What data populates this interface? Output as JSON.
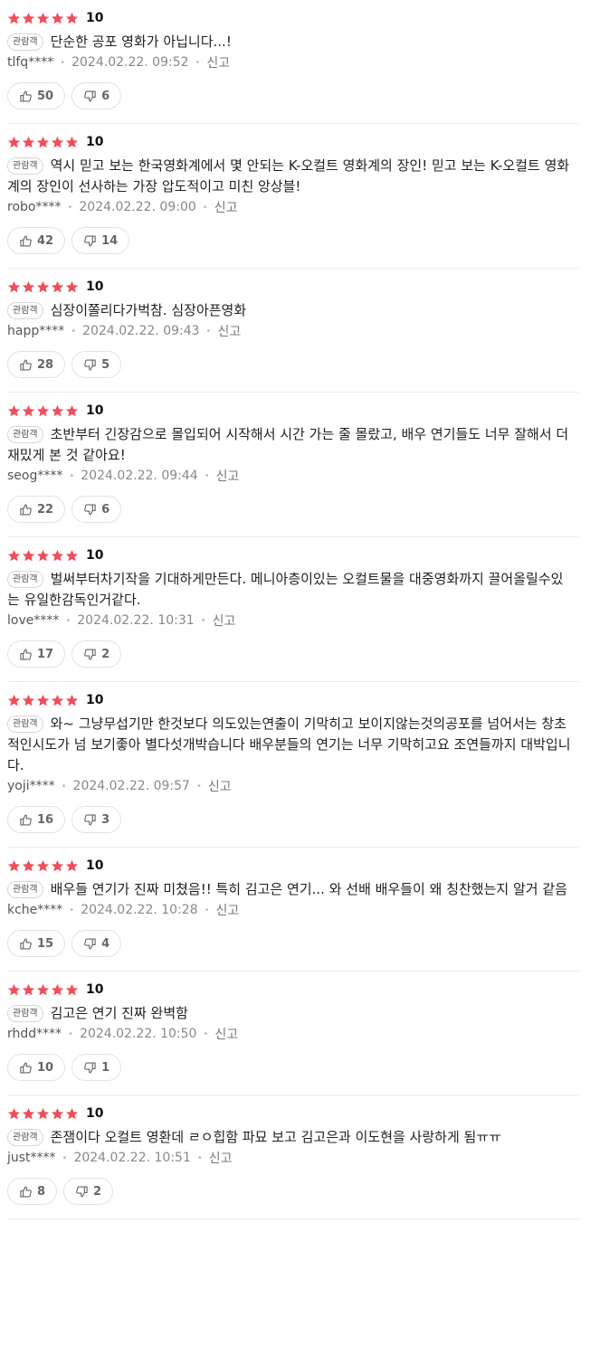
{
  "colors": {
    "star": "#ef4e5a",
    "text": "#1f1f1f",
    "meta": "#888888",
    "border": "#e3e3e3"
  },
  "reviews": [
    {
      "score": "10",
      "badge": "관람객",
      "content": "단순한 공포 영화가 아닙니다...!",
      "user": "tlfq****",
      "date": "2024.02.22. 09:52",
      "report": "신고",
      "likes": "50",
      "dislikes": "6"
    },
    {
      "score": "10",
      "badge": "관람객",
      "content": "역시 믿고 보는 한국영화계에서 몇 안되는 K-오컬트 영화계의 장인! 믿고 보는 K-오컬트 영화계의 장인이 선사하는 가장 압도적이고 미친 앙상블!",
      "user": "robo****",
      "date": "2024.02.22. 09:00",
      "report": "신고",
      "likes": "42",
      "dislikes": "14"
    },
    {
      "score": "10",
      "badge": "관람객",
      "content": "심장이쫄리다가벅참. 심장아픈영화",
      "user": "happ****",
      "date": "2024.02.22. 09:43",
      "report": "신고",
      "likes": "28",
      "dislikes": "5"
    },
    {
      "score": "10",
      "badge": "관람객",
      "content": "초반부터 긴장감으로 몰입되어 시작해서 시간 가는 줄 몰랐고, 배우 연기들도 너무 잘해서 더 재밌게 본 것 같아요!",
      "user": "seog****",
      "date": "2024.02.22. 09:44",
      "report": "신고",
      "likes": "22",
      "dislikes": "6"
    },
    {
      "score": "10",
      "badge": "관람객",
      "content": "벌써부터차기작을 기대하게만든다. 메니아층이있는 오컬트물을 대중영화까지 끌어올릴수있는 유일한감독인거같다.",
      "user": "love****",
      "date": "2024.02.22. 10:31",
      "report": "신고",
      "likes": "17",
      "dislikes": "2"
    },
    {
      "score": "10",
      "badge": "관람객",
      "content": "와~ 그냥무섭기만 한것보다 의도있는연출이 기막히고 보이지않는것의공포를 넘어서는 창초적인시도가 넘 보기좋아 별다섯개박습니다 배우분들의 연기는 너무 기막히고요 조연들까지 대박입니다.",
      "user": "yoji****",
      "date": "2024.02.22. 09:57",
      "report": "신고",
      "likes": "16",
      "dislikes": "3"
    },
    {
      "score": "10",
      "badge": "관람객",
      "content": "배우들 연기가 진짜 미쳤음!! 특히 김고은 연기... 와 선배 배우들이 왜 칭찬했는지 알거 같음",
      "user": "kche****",
      "date": "2024.02.22. 10:28",
      "report": "신고",
      "likes": "15",
      "dislikes": "4"
    },
    {
      "score": "10",
      "badge": "관람객",
      "content": "김고은 연기 진짜 완벽함",
      "user": "rhdd****",
      "date": "2024.02.22. 10:50",
      "report": "신고",
      "likes": "10",
      "dislikes": "1"
    },
    {
      "score": "10",
      "badge": "관람객",
      "content": "존잼이다 오컬트 영환데 ㄹㅇ힙함 파묘 보고 김고은과 이도현을 사랑하게 됨ㅠㅠ",
      "user": "just****",
      "date": "2024.02.22. 10:51",
      "report": "신고",
      "likes": "8",
      "dislikes": "2"
    }
  ]
}
